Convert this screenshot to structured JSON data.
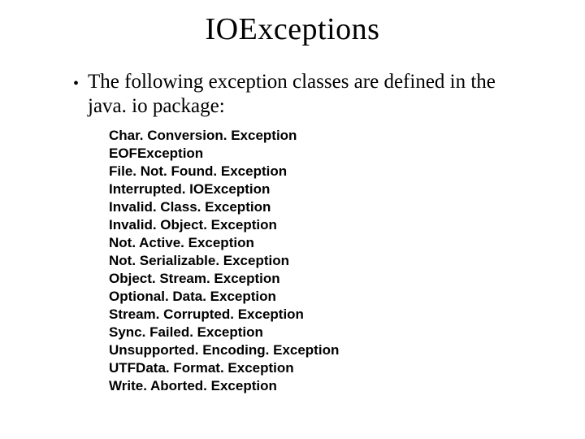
{
  "title": "IOExceptions",
  "bullet": "The following exception classes are defined in the java. io package:",
  "classes": [
    "Char. Conversion. Exception",
    "EOFException",
    "File. Not. Found. Exception",
    "Interrupted. IOException",
    "Invalid. Class. Exception",
    "Invalid. Object. Exception",
    "Not. Active. Exception",
    "Not. Serializable. Exception",
    "Object. Stream. Exception",
    "Optional. Data. Exception",
    "Stream. Corrupted. Exception",
    "Sync. Failed. Exception",
    "Unsupported. Encoding. Exception",
    "UTFData. Format. Exception",
    "Write. Aborted. Exception"
  ]
}
